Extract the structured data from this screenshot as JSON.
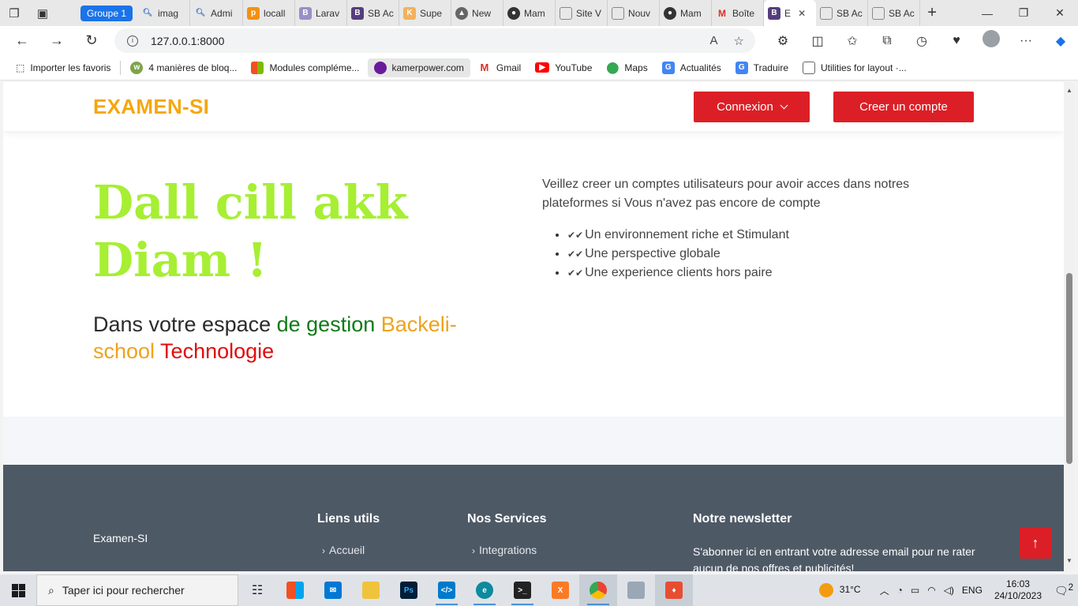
{
  "browser": {
    "group_label": "Groupe 1",
    "tabs": [
      {
        "label": "imag",
        "icon": "search-icon"
      },
      {
        "label": "Admi",
        "icon": "search-icon"
      },
      {
        "label": "locall",
        "icon": "phpmyadmin-icon"
      },
      {
        "label": "Larav",
        "icon": "bootstrap-icon"
      },
      {
        "label": "SB Ac",
        "icon": "bootstrap-icon"
      },
      {
        "label": "Supe",
        "icon": "k-icon"
      },
      {
        "label": "New",
        "icon": "triangle-icon"
      },
      {
        "label": "Mam",
        "icon": "github-icon"
      },
      {
        "label": "Site V",
        "icon": "page-icon"
      },
      {
        "label": "Nouv",
        "icon": "page-icon"
      },
      {
        "label": "Mam",
        "icon": "github-icon"
      },
      {
        "label": "Boîte",
        "icon": "gmail-icon"
      },
      {
        "label": "E",
        "icon": "bootstrap-icon",
        "active": true
      },
      {
        "label": "SB Ac",
        "icon": "page-icon"
      },
      {
        "label": "SB Ac",
        "icon": "page-icon"
      }
    ],
    "url": "127.0.0.1:8000",
    "bookmarks": [
      {
        "label": "Importer les favoris",
        "icon": "import-icon"
      },
      {
        "label": "4 manières de bloq...",
        "icon": "wikihow-icon"
      },
      {
        "label": "Modules compléme...",
        "icon": "microsoft-icon"
      },
      {
        "label": "kamerpower.com",
        "icon": "kamerpower-icon",
        "highlight": true
      },
      {
        "label": "Gmail",
        "icon": "gmail-icon"
      },
      {
        "label": "YouTube",
        "icon": "youtube-icon"
      },
      {
        "label": "Maps",
        "icon": "maps-icon"
      },
      {
        "label": "Actualités",
        "icon": "news-icon"
      },
      {
        "label": "Traduire",
        "icon": "translate-icon"
      },
      {
        "label": "Utilities for layout ·...",
        "icon": "page-icon"
      }
    ]
  },
  "header": {
    "brand": "EXAMEN-SI",
    "login_label": "Connexion",
    "signup_label": "Creer un compte"
  },
  "hero": {
    "title_line1": "Dall cill akk",
    "title_line2": "Diam !",
    "sub_part1": "Dans votre espace ",
    "sub_part2": "de gestion",
    "sub_part3": " Backeli-school",
    "sub_part4": " Technologie"
  },
  "intro": {
    "text": "Veillez creer un comptes utilisateurs pour avoir acces dans notres plateformes si Vous n'avez pas encore de compte",
    "features": [
      "Un environnement riche et Stimulant",
      "Une perspective globale",
      "Une experience clients hors paire"
    ]
  },
  "footer": {
    "brand": "Examen-SI",
    "links_title": "Liens utils",
    "links": [
      "Accueil"
    ],
    "services_title": "Nos Services",
    "services": [
      "Integrations"
    ],
    "newsletter_title": "Notre newsletter",
    "newsletter_text": "S'abonner ici en entrant votre adresse email pour ne rater aucun de nos offres et publicités!"
  },
  "taskbar": {
    "search_placeholder": "Taper ici pour rechercher",
    "weather": "31°C",
    "lang": "ENG",
    "time": "16:03",
    "date": "24/10/2023",
    "notif_count": "2"
  },
  "colors": {
    "brand": "#f5a70c",
    "button_red": "#dc1f26",
    "hero_title": "#a6ef33",
    "footer_bg": "#4e5966"
  }
}
